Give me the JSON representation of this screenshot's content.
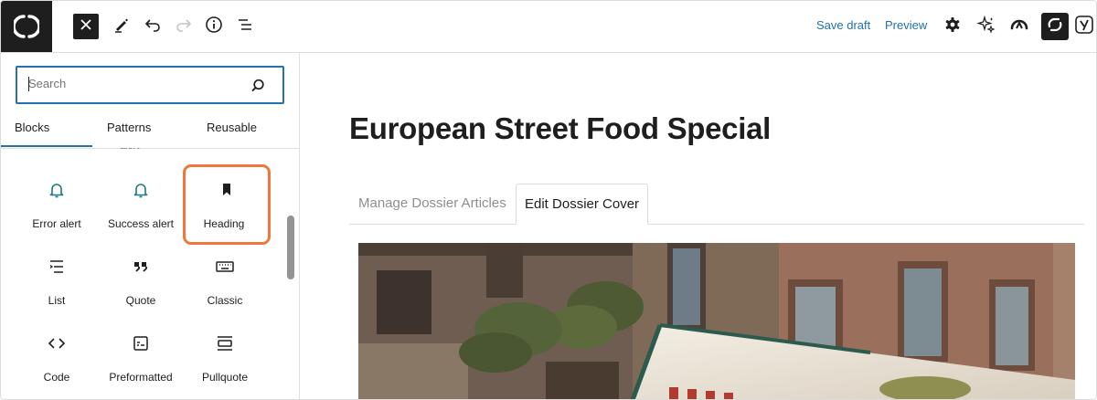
{
  "toolbar": {
    "logo_icon": "logo-icon",
    "close_icon": "close-icon",
    "tools_icon": "pencil-icon",
    "undo_icon": "undo-icon",
    "redo_icon": "redo-icon",
    "info_icon": "info-icon",
    "list_view_icon": "list-view-icon",
    "save_draft_label": "Save draft",
    "preview_label": "Preview",
    "right_icons": [
      "settings-icon",
      "sparkle-icon",
      "performance-icon",
      "plugin-icon",
      "yoast-icon"
    ]
  },
  "inserter": {
    "search_placeholder": "Search",
    "tabs": [
      {
        "label": "Blocks",
        "active": true
      },
      {
        "label": "Patterns",
        "active": false
      },
      {
        "label": "Reusable",
        "active": false
      }
    ],
    "cut_off_label": "alert",
    "blocks": [
      {
        "label": "Error alert",
        "icon": "bell-icon",
        "selected": false
      },
      {
        "label": "Success alert",
        "icon": "bell-icon",
        "selected": false
      },
      {
        "label": "Heading",
        "icon": "bookmark-icon",
        "selected": true
      },
      {
        "label": "List",
        "icon": "list-icon",
        "selected": false
      },
      {
        "label": "Quote",
        "icon": "quote-icon",
        "selected": false
      },
      {
        "label": "Classic",
        "icon": "keyboard-icon",
        "selected": false
      },
      {
        "label": "Code",
        "icon": "code-icon",
        "selected": false
      },
      {
        "label": "Preformatted",
        "icon": "preformatted-icon",
        "selected": false
      },
      {
        "label": "Pullquote",
        "icon": "pullquote-icon",
        "selected": false
      }
    ]
  },
  "editor": {
    "title": "European Street Food Special",
    "dossier_tabs": [
      {
        "label": "Manage Dossier Articles",
        "active": false
      },
      {
        "label": "Edit Dossier Cover",
        "active": true
      }
    ],
    "cover_image": "street-cafe-photo"
  },
  "colors": {
    "accent": "#2271b1",
    "selection": "#f0773c",
    "alert_icon": "#1f7a83",
    "dark": "#1e1e1e"
  }
}
